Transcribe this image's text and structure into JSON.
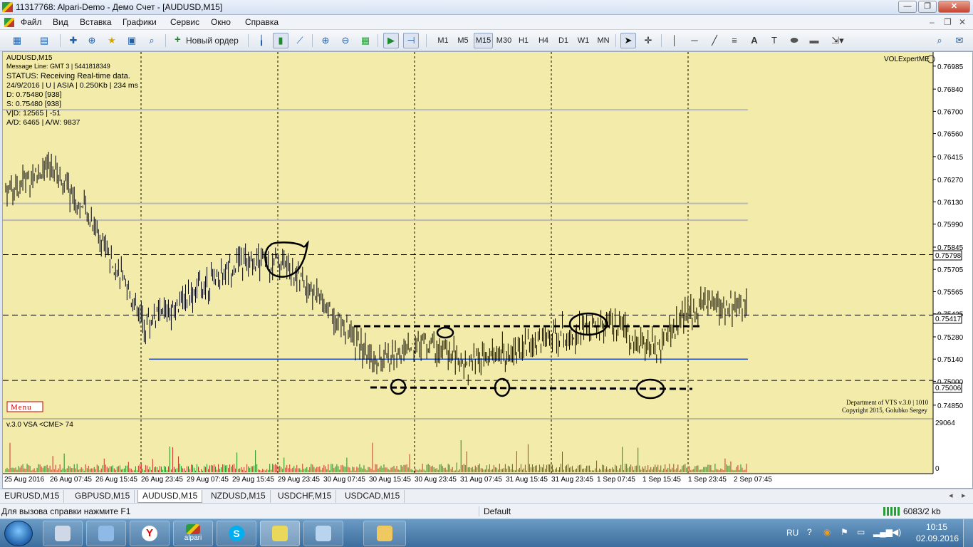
{
  "window": {
    "title": "11317768: Alpari-Demo - Демо Счет - [AUDUSD,M15]",
    "buttons": {
      "minimize": "—",
      "restore": "❐",
      "close": "✕"
    }
  },
  "menu": {
    "items": [
      "Файл",
      "Вид",
      "Вставка",
      "Графики",
      "Сервис",
      "Окно",
      "Справка"
    ],
    "doc_buttons": {
      "minimize": "–",
      "restore": "❐",
      "close": "✕"
    }
  },
  "toolbar": {
    "new_order_label": "Новый ордер",
    "timeframes": [
      "M1",
      "M5",
      "M15",
      "M30",
      "H1",
      "H4",
      "D1",
      "W1",
      "MN"
    ],
    "active_timeframe": "M15"
  },
  "chart": {
    "symbol_header": "AUDUSD,M15",
    "info_lines": [
      "Message Line: GMT 3 | 5441818349",
      "STATUS:  Receiving Real-time data.",
      "24/9/2016 | U | ASIA | 0.250Kb | 234 ms",
      "D: 0.75480  [938]",
      "S: 0.75480  [938]",
      "V|D: 12565 | -51",
      "A/D: 6465 | A/W: 9837"
    ],
    "expert_label": "VOLExpertME",
    "menu_button": "Menu",
    "copyright_lines": [
      "Department of VTS  v.3.0 | 1010",
      "Copyright 2015, Golubko Sergey"
    ],
    "sub_label": "v.3.0 VSA <CME> 74",
    "sub_top_value": "29064",
    "sub_zero": "0",
    "colors": {
      "background": "#f3eba9",
      "candles": "#000000",
      "blue_line": "#2050c8",
      "grey_lines": "#b8b8b8",
      "volume_green": "#1c8c1c",
      "volume_red": "#c83228"
    }
  },
  "chart_data": {
    "type": "line",
    "title": "AUDUSD,M15",
    "price_axis_labels": [
      "0.76985",
      "0.76840",
      "0.76700",
      "0.76560",
      "0.76415",
      "0.76270",
      "0.76130",
      "0.75990",
      "0.75845",
      "0.75705",
      "0.75565",
      "0.75425",
      "0.75280",
      "0.75140",
      "0.75000",
      "0.74850"
    ],
    "price_markers": [
      "0.75798",
      "0.75417",
      "0.75006"
    ],
    "time_labels": [
      "25 Aug 2016",
      "26 Aug 07:45",
      "26 Aug 15:45",
      "26 Aug 23:45",
      "29 Aug 07:45",
      "29 Aug 15:45",
      "29 Aug 23:45",
      "30 Aug 07:45",
      "30 Aug 15:45",
      "30 Aug 23:45",
      "31 Aug 07:45",
      "31 Aug 15:45",
      "31 Aug 23:45",
      "1 Sep 07:45",
      "1 Sep 15:45",
      "1 Sep 23:45",
      "2 Sep 07:45"
    ],
    "series": [
      {
        "x": [
          "25 Aug 2016",
          "26 Aug 07:45",
          "26 Aug 15:45",
          "26 Aug 23:45",
          "29 Aug 07:45",
          "29 Aug 15:45",
          "29 Aug 23:45",
          "30 Aug 07:45",
          "30 Aug 15:45",
          "30 Aug 23:45",
          "31 Aug 07:45",
          "31 Aug 15:45",
          "31 Aug 23:45",
          "1 Sep 07:45",
          "1 Sep 15:45",
          "1 Sep 23:45",
          "2 Sep 07:45"
        ],
        "values": [
          0.762,
          0.7635,
          0.7595,
          0.7535,
          0.7555,
          0.7575,
          0.7575,
          0.7545,
          0.751,
          0.7525,
          0.751,
          0.752,
          0.753,
          0.7535,
          0.752,
          0.755,
          0.7545
        ]
      }
    ],
    "ylim": [
      0.748,
      0.7702
    ],
    "horizontal_lines": [
      0.75798,
      0.75417,
      0.75006,
      0.7514,
      0.7612,
      0.76015,
      0.7671
    ]
  },
  "tabs": [
    "EURUSD,M15",
    "GBPUSD,M15",
    "AUDUSD,M15",
    "NZDUSD,M15",
    "USDCHF,M15",
    "USDCAD,M15"
  ],
  "active_tab": "AUDUSD,M15",
  "status": {
    "help": "Для вызова справки нажмите F1",
    "profile": "Default",
    "traffic": "6083/2 kb"
  },
  "taskbar": {
    "apps": [
      "alpari"
    ],
    "lang": "RU",
    "time": "10:15",
    "date": "02.09.2016"
  }
}
